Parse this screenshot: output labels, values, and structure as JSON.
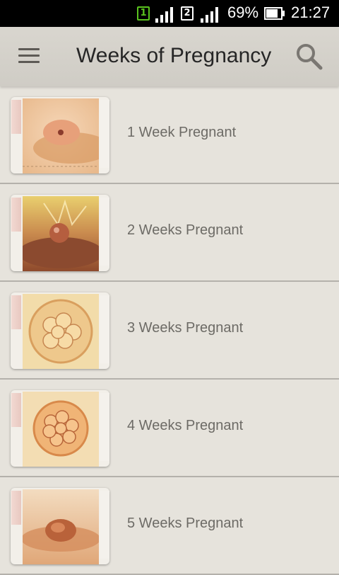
{
  "status_bar": {
    "sim1": "1",
    "sim2": "2",
    "battery_percent": "69%",
    "time": "21:27",
    "sim1_color": "#5ac31e"
  },
  "app_bar": {
    "menu_icon": "hamburger-menu-icon",
    "title": "Weeks of Pregnancy",
    "search_icon": "search-icon"
  },
  "weeks": [
    {
      "label": "1 Week Pregnant",
      "thumb_icon": "embryo-week-1-image"
    },
    {
      "label": "2 Weeks Pregnant",
      "thumb_icon": "embryo-week-2-image"
    },
    {
      "label": "3 Weeks Pregnant",
      "thumb_icon": "embryo-week-3-image"
    },
    {
      "label": "4 Weeks Pregnant",
      "thumb_icon": "embryo-week-4-image"
    },
    {
      "label": "5 Weeks Pregnant",
      "thumb_icon": "embryo-week-5-image"
    }
  ],
  "colors": {
    "background": "#e6e3dc",
    "app_bar": "#d4d1ca",
    "divider": "#b4b1ab",
    "label_text": "#6d6b66",
    "title_text": "#262626"
  }
}
